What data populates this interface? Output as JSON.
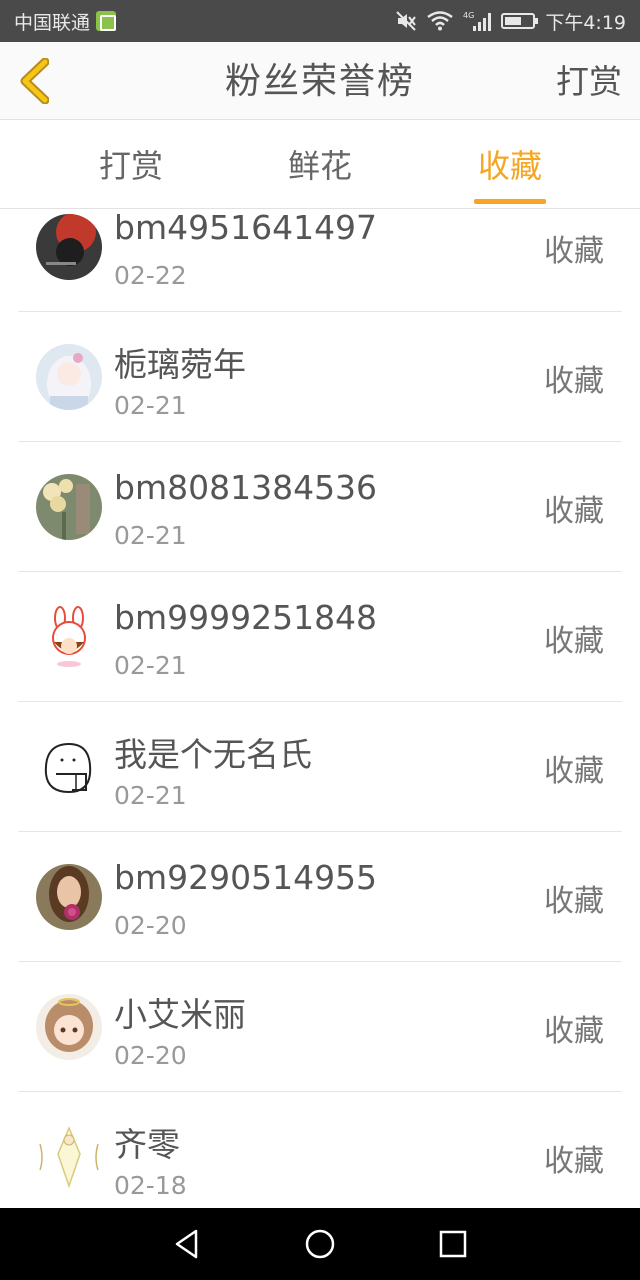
{
  "status_bar": {
    "carrier": "中国联通",
    "network": "4G",
    "time": "下午4:19",
    "battery_level": 0.6
  },
  "header": {
    "title": "粉丝荣誉榜",
    "action_label": "打赏"
  },
  "tabs": [
    {
      "label": "打赏",
      "active": false
    },
    {
      "label": "鲜花",
      "active": false
    },
    {
      "label": "收藏",
      "active": true
    }
  ],
  "accent_color": "#f5a623",
  "list": [
    {
      "name": "bm4951641497",
      "date": "02-22",
      "action": "收藏",
      "avatar": "avatar-dark-red"
    },
    {
      "name": "栀璃菀年",
      "date": "02-21",
      "action": "收藏",
      "avatar": "avatar-anime-white"
    },
    {
      "name": "bm8081384536",
      "date": "02-21",
      "action": "收藏",
      "avatar": "avatar-flowers"
    },
    {
      "name": "bm9999251848",
      "date": "02-21",
      "action": "收藏",
      "avatar": "avatar-bunny"
    },
    {
      "name": "我是个无名氏",
      "date": "02-21",
      "action": "收藏",
      "avatar": "avatar-sketch"
    },
    {
      "name": "bm9290514955",
      "date": "02-20",
      "action": "收藏",
      "avatar": "avatar-girl-rose"
    },
    {
      "name": "小艾米丽",
      "date": "02-20",
      "action": "收藏",
      "avatar": "avatar-anime-girl"
    },
    {
      "name": "齐零",
      "date": "02-18",
      "action": "收藏",
      "avatar": "avatar-figure"
    }
  ],
  "nav": {
    "back": "back-triangle-icon",
    "home": "home-circle-icon",
    "recents": "recents-square-icon"
  }
}
